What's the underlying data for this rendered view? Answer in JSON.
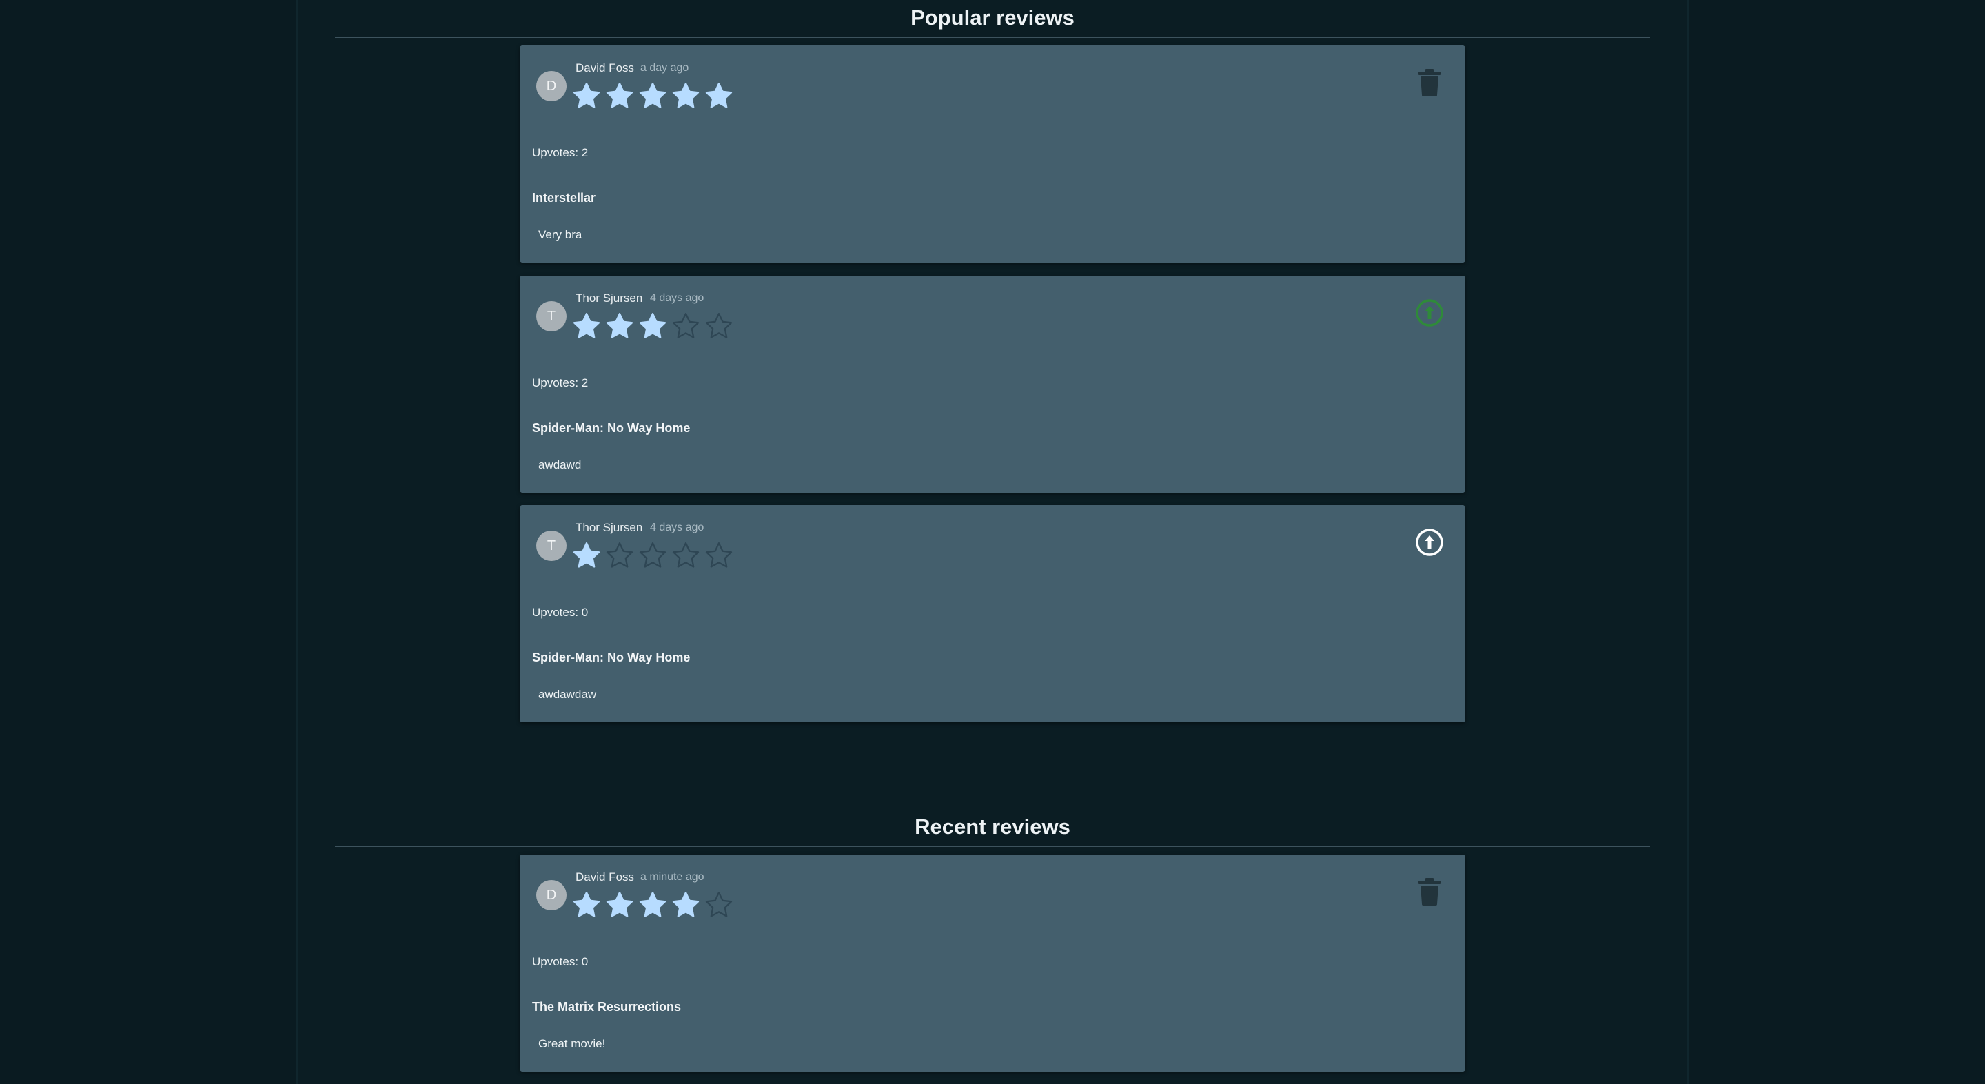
{
  "colors": {
    "star_filled": "#b7dcff",
    "star_empty_stroke": "#2e4654",
    "upvote_active": "#2f8a3a",
    "upvote_default": "#ffffff",
    "trash": "#22343c"
  },
  "popular": {
    "title": "Popular reviews",
    "reviews": [
      {
        "initial": "D",
        "author": "David Foss",
        "time": "a day ago",
        "rating": 5,
        "upvotes": "Upvotes: 2",
        "movie": "Interstellar",
        "text": "Very bra",
        "action_icon": "trash-icon"
      },
      {
        "initial": "T",
        "author": "Thor Sjursen",
        "time": "4 days ago",
        "rating": 3,
        "upvotes": "Upvotes: 2",
        "movie": "Spider-Man: No Way Home",
        "text": "awdawd",
        "action_icon": "upvote-icon",
        "upvoted": true
      },
      {
        "initial": "T",
        "author": "Thor Sjursen",
        "time": "4 days ago",
        "rating": 1,
        "upvotes": "Upvotes: 0",
        "movie": "Spider-Man: No Way Home",
        "text": "awdawdaw",
        "action_icon": "upvote-icon",
        "upvoted": false
      }
    ]
  },
  "recent": {
    "title": "Recent reviews",
    "reviews": [
      {
        "initial": "D",
        "author": "David Foss",
        "time": "a minute ago",
        "rating": 4,
        "upvotes": "Upvotes: 0",
        "movie": "The Matrix Resurrections",
        "text": "Great movie!",
        "action_icon": "trash-icon"
      }
    ]
  }
}
